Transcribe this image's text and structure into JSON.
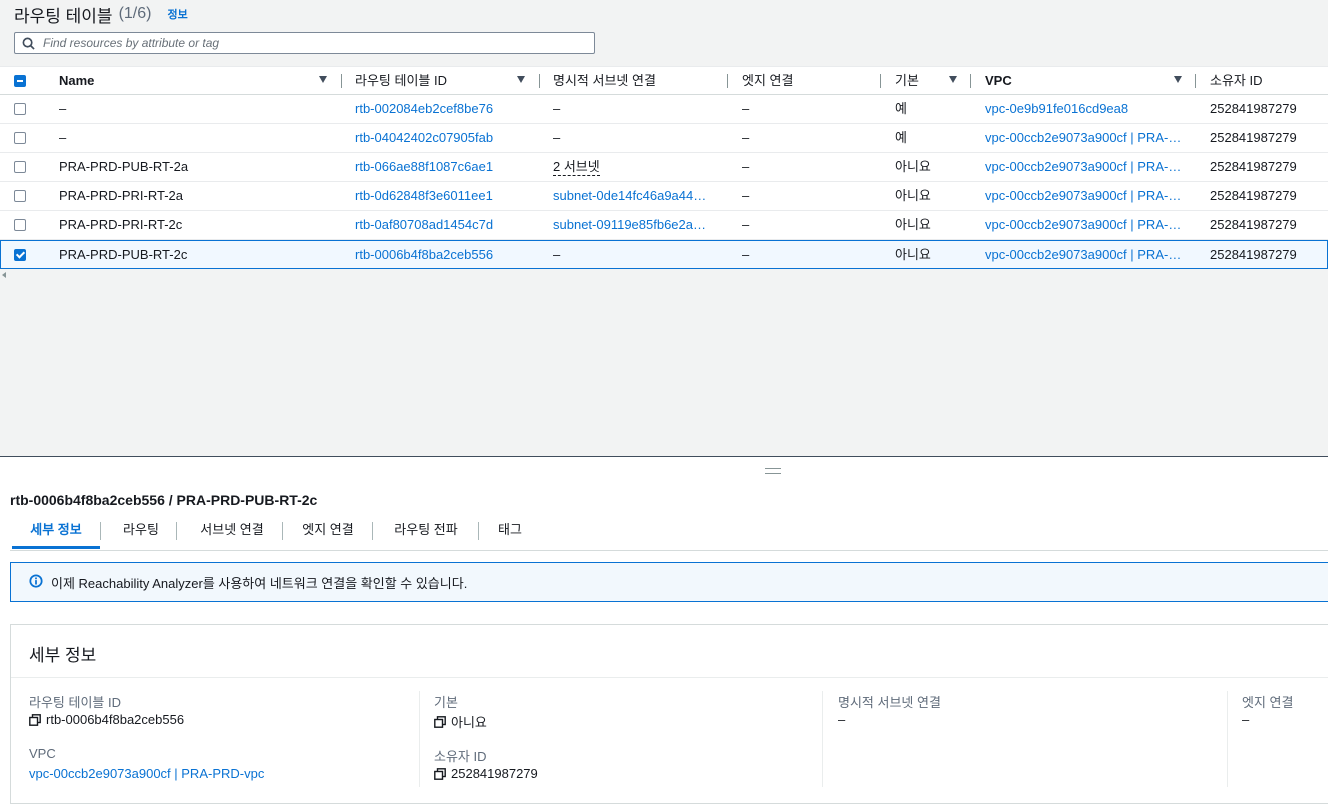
{
  "header": {
    "title": "라우팅 테이블",
    "count": "(1/6)",
    "info": "정보"
  },
  "search": {
    "placeholder": "Find resources by attribute or tag"
  },
  "table": {
    "columns": {
      "name": "Name",
      "rtb_id": "라우팅 테이블 ID",
      "explicit_subnet": "명시적 서브넷 연결",
      "edge": "엣지 연결",
      "main": "기본",
      "vpc": "VPC",
      "owner": "소유자 ID"
    },
    "rows": [
      {
        "name": "–",
        "rtb_id": "rtb-002084eb2cef8be76",
        "subnet": "–",
        "edge": "–",
        "main": "예",
        "vpc": "vpc-0e9b91fe016cd9ea8",
        "owner": "252841987279",
        "selected": false
      },
      {
        "name": "–",
        "rtb_id": "rtb-04042402c07905fab",
        "subnet": "–",
        "edge": "–",
        "main": "예",
        "vpc": "vpc-00ccb2e9073a900cf | PRA-…",
        "owner": "252841987279",
        "selected": false
      },
      {
        "name": "PRA-PRD-PUB-RT-2a",
        "rtb_id": "rtb-066ae88f1087c6ae1",
        "subnet": "2 서브넷",
        "edge": "–",
        "main": "아니요",
        "vpc": "vpc-00ccb2e9073a900cf | PRA-…",
        "owner": "252841987279",
        "selected": false
      },
      {
        "name": "PRA-PRD-PRI-RT-2a",
        "rtb_id": "rtb-0d62848f3e6011ee1",
        "subnet": "subnet-0de14fc46a9a44…",
        "edge": "–",
        "main": "아니요",
        "vpc": "vpc-00ccb2e9073a900cf | PRA-…",
        "owner": "252841987279",
        "selected": false
      },
      {
        "name": "PRA-PRD-PRI-RT-2c",
        "rtb_id": "rtb-0af80708ad1454c7d",
        "subnet": "subnet-09119e85fb6e2a…",
        "edge": "–",
        "main": "아니요",
        "vpc": "vpc-00ccb2e9073a900cf | PRA-…",
        "owner": "252841987279",
        "selected": false
      },
      {
        "name": "PRA-PRD-PUB-RT-2c",
        "rtb_id": "rtb-0006b4f8ba2ceb556",
        "subnet": "–",
        "edge": "–",
        "main": "아니요",
        "vpc": "vpc-00ccb2e9073a900cf | PRA-…",
        "owner": "252841987279",
        "selected": true
      }
    ]
  },
  "detail": {
    "title": "rtb-0006b4f8ba2ceb556 / PRA-PRD-PUB-RT-2c",
    "tabs": [
      "세부 정보",
      "라우팅",
      "서브넷 연결",
      "엣지 연결",
      "라우팅 전파",
      "태그"
    ],
    "alert": "이제 Reachability Analyzer를 사용하여 네트워크 연결을 확인할 수 있습니다.",
    "card_title": "세부 정보",
    "fields": {
      "rtb_id_label": "라우팅 테이블 ID",
      "rtb_id_value": "rtb-0006b4f8ba2ceb556",
      "vpc_label": "VPC",
      "vpc_value": "vpc-00ccb2e9073a900cf | PRA-PRD-vpc",
      "main_label": "기본",
      "main_value": "아니요",
      "owner_label": "소유자 ID",
      "owner_value": "252841987279",
      "explicit_label": "명시적 서브넷 연결",
      "explicit_value": "–",
      "edge_label": "엣지 연결",
      "edge_value": "–"
    }
  },
  "colors": {
    "link": "#0972d3",
    "selected_bg": "#f1f8ff",
    "panel_bg": "#f2f3f3"
  },
  "icons": {
    "search": "search-icon",
    "sort": "sort-caret-icon",
    "info": "info-circle-icon",
    "copy": "copy-icon"
  }
}
